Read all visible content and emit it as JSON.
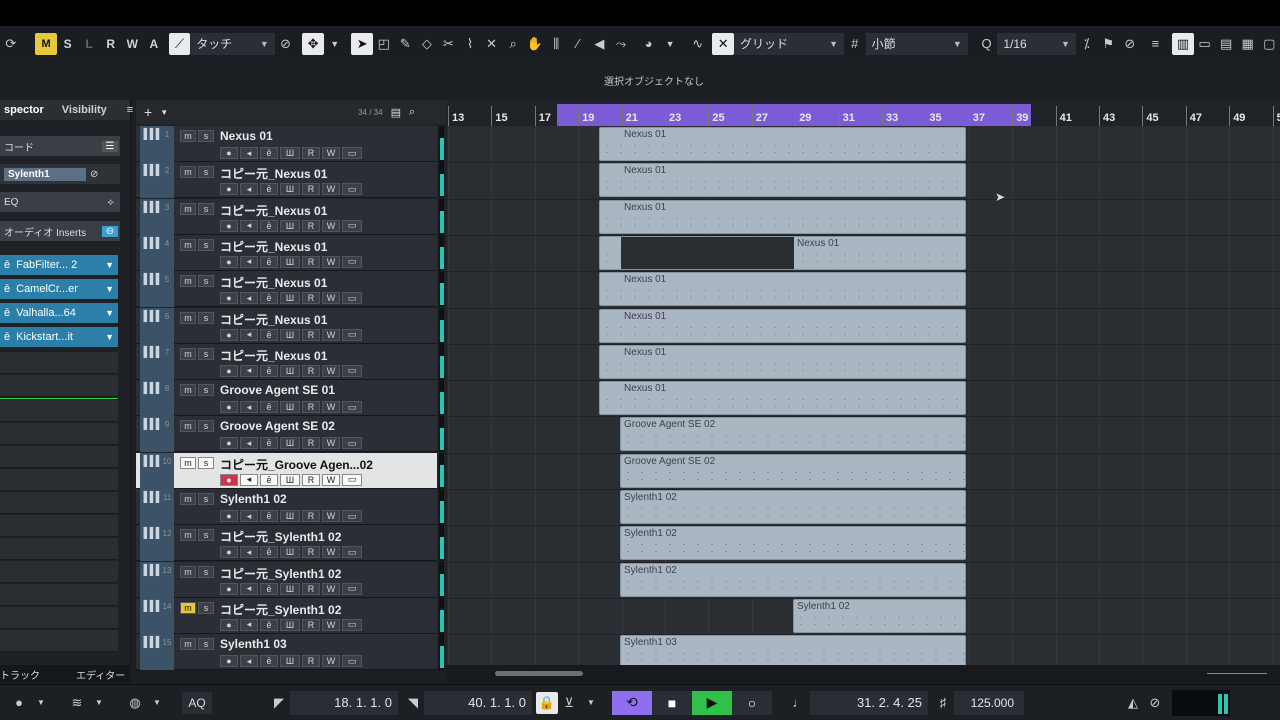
{
  "toolbar": {
    "buttons_msrwa": [
      "M",
      "S",
      "L",
      "R",
      "W",
      "A"
    ],
    "automation_mode": "タッチ",
    "snap_type": "グリッド",
    "grid_type": "小節",
    "quantize": "1/16"
  },
  "status_message": "選択オブジェクトなし",
  "inspector": {
    "tabs": [
      "spector",
      "Visibility"
    ],
    "rows": [
      "コード",
      "Sylenth1",
      "EQ",
      "オーディオ Inserts"
    ],
    "inserts": [
      "FabFilter... 2",
      "CamelCr...er",
      "Valhalla...64",
      "Kickstart...it"
    ],
    "bottom_tabs": [
      "トラック",
      "エディター"
    ]
  },
  "tracklist": {
    "count": "34 / 34",
    "tracks": [
      {
        "num": "1",
        "name": "Nexus 01"
      },
      {
        "num": "2",
        "name": "コピー元_Nexus 01"
      },
      {
        "num": "3",
        "name": "コピー元_Nexus 01"
      },
      {
        "num": "4",
        "name": "コピー元_Nexus 01"
      },
      {
        "num": "5",
        "name": "コピー元_Nexus 01"
      },
      {
        "num": "6",
        "name": "コピー元_Nexus 01"
      },
      {
        "num": "7",
        "name": "コピー元_Nexus 01"
      },
      {
        "num": "8",
        "name": "Groove Agent SE 01"
      },
      {
        "num": "9",
        "name": "Groove Agent SE 02"
      },
      {
        "num": "10",
        "name": "コピー元_Groove Agen...02"
      },
      {
        "num": "11",
        "name": "Sylenth1 02"
      },
      {
        "num": "12",
        "name": "コピー元_Sylenth1 02"
      },
      {
        "num": "13",
        "name": "コピー元_Sylenth1 02"
      },
      {
        "num": "14",
        "name": "コピー元_Sylenth1 02"
      },
      {
        "num": "15",
        "name": "Sylenth1 03"
      }
    ]
  },
  "ruler": [
    "13",
    "15",
    "17",
    "19",
    "21",
    "23",
    "25",
    "27",
    "29",
    "31",
    "33",
    "35",
    "37",
    "39",
    "41",
    "43",
    "45",
    "47",
    "49",
    "5"
  ],
  "parts": [
    "Nexus 01",
    "Nexus 01",
    "Nexus 01",
    "Nexus 01",
    "Nexus 01",
    "Nexus 01",
    "Nexus 01",
    "Nexus 01",
    "Groove Agent SE 02",
    "Groove Agent SE 02",
    "Sylenth1 02",
    "Sylenth1 02",
    "Sylenth1 02",
    "Sylenth1 02",
    "Sylenth1 03"
  ],
  "transport": {
    "left_locator": "18. 1. 1.   0",
    "right_locator": "40. 1. 1.   0",
    "aq": "AQ",
    "position": "31. 2. 4. 25",
    "tempo": "125.000"
  },
  "colors": {
    "locator_range": "#7b5bd6",
    "part": "#aab6c2",
    "insert_slot": "#2b7fa8",
    "mute_active": "#e6c93a",
    "play": "#2fc24a",
    "cycle": "#8f6ff0"
  }
}
